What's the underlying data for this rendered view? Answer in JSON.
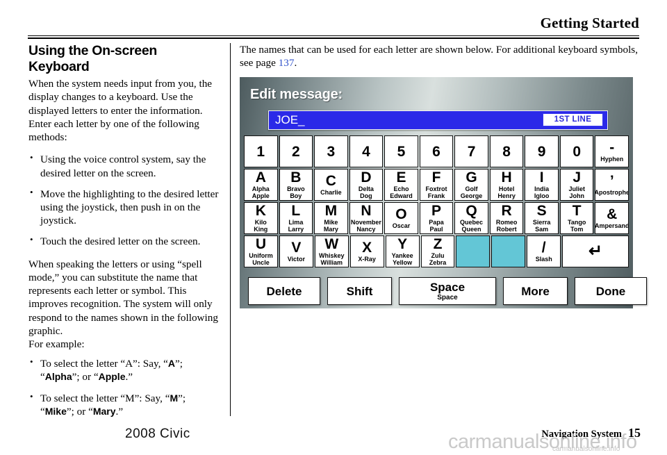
{
  "header": {
    "title": "Getting Started"
  },
  "left_column": {
    "heading": "Using the On-screen Keyboard",
    "intro": "When the system needs input from you, the display changes to a keyboard. Use the displayed letters to enter the information. Enter each letter by one of the following methods:",
    "bullets_1": [
      "Using the voice control system, say the desired letter on the screen.",
      "Move the highlighting to the desired letter using the joystick, then push in on the joystick.",
      "Touch the desired letter on the screen."
    ],
    "paragraph_2": "When speaking the letters or using “spell mode,” you can substitute the name that represents each letter or symbol. This improves recognition. The system will only respond to the names shown in the following graphic.",
    "paragraph_3": "For example:",
    "example_a": {
      "pre": "To select the letter “A”: Say, “",
      "b1": "A",
      "mid1": "”; “",
      "b2": "Alpha",
      "mid2": "”; or “",
      "b3": "Apple",
      "post": ".”"
    },
    "example_m": {
      "pre": "To select the letter “M”: Say, “",
      "b1": "M",
      "mid1": "”; “",
      "b2": "Mike",
      "mid2": "”; or “",
      "b3": "Mary",
      "post": ".”"
    }
  },
  "right_column": {
    "intro_pre": "The names that can be used for each letter are shown below. For additional keyboard symbols, see page ",
    "intro_page_ref": "137",
    "intro_post": "."
  },
  "keyboard": {
    "panel_title": "Edit message:",
    "text_field": {
      "value": "JOE_",
      "badge": "1ST LINE"
    },
    "rows": [
      [
        {
          "glyph": "1",
          "sub": []
        },
        {
          "glyph": "2",
          "sub": []
        },
        {
          "glyph": "3",
          "sub": []
        },
        {
          "glyph": "4",
          "sub": []
        },
        {
          "glyph": "5",
          "sub": []
        },
        {
          "glyph": "6",
          "sub": []
        },
        {
          "glyph": "7",
          "sub": []
        },
        {
          "glyph": "8",
          "sub": []
        },
        {
          "glyph": "9",
          "sub": []
        },
        {
          "glyph": "0",
          "sub": []
        },
        {
          "glyph": "-",
          "sub": [
            "Hyphen"
          ]
        }
      ],
      [
        {
          "glyph": "A",
          "sub": [
            "Alpha",
            "Apple"
          ]
        },
        {
          "glyph": "B",
          "sub": [
            "Bravo",
            "Boy"
          ]
        },
        {
          "glyph": "C",
          "sub": [
            "Charlie"
          ]
        },
        {
          "glyph": "D",
          "sub": [
            "Delta",
            "Dog"
          ]
        },
        {
          "glyph": "E",
          "sub": [
            "Echo",
            "Edward"
          ]
        },
        {
          "glyph": "F",
          "sub": [
            "Foxtrot",
            "Frank"
          ]
        },
        {
          "glyph": "G",
          "sub": [
            "Golf",
            "George"
          ]
        },
        {
          "glyph": "H",
          "sub": [
            "Hotel",
            "Henry"
          ]
        },
        {
          "glyph": "I",
          "sub": [
            "India",
            "Igloo"
          ]
        },
        {
          "glyph": "J",
          "sub": [
            "Juliet",
            "John"
          ]
        },
        {
          "glyph": "’",
          "sub": [
            "Apostrophe"
          ]
        }
      ],
      [
        {
          "glyph": "K",
          "sub": [
            "Kilo",
            "King"
          ]
        },
        {
          "glyph": "L",
          "sub": [
            "Lima",
            "Larry"
          ]
        },
        {
          "glyph": "M",
          "sub": [
            "Mike",
            "Mary"
          ]
        },
        {
          "glyph": "N",
          "sub": [
            "November",
            "Nancy"
          ]
        },
        {
          "glyph": "O",
          "sub": [
            "Oscar"
          ]
        },
        {
          "glyph": "P",
          "sub": [
            "Papa",
            "Paul"
          ]
        },
        {
          "glyph": "Q",
          "sub": [
            "Quebec",
            "Queen"
          ]
        },
        {
          "glyph": "R",
          "sub": [
            "Romeo",
            "Robert"
          ]
        },
        {
          "glyph": "S",
          "sub": [
            "Sierra",
            "Sam"
          ]
        },
        {
          "glyph": "T",
          "sub": [
            "Tango",
            "Tom"
          ]
        },
        {
          "glyph": "&",
          "sub": [
            "Ampersand"
          ]
        }
      ],
      [
        {
          "glyph": "U",
          "sub": [
            "Uniform",
            "Uncle"
          ]
        },
        {
          "glyph": "V",
          "sub": [
            "Victor"
          ]
        },
        {
          "glyph": "W",
          "sub": [
            "Whiskey",
            "William"
          ]
        },
        {
          "glyph": "X",
          "sub": [
            "X-Ray"
          ]
        },
        {
          "glyph": "Y",
          "sub": [
            "Yankee",
            "Yellow"
          ]
        },
        {
          "glyph": "Z",
          "sub": [
            "Zulu",
            "Zebra"
          ]
        },
        {
          "glyph": "",
          "sub": [],
          "blank": true
        },
        {
          "glyph": "",
          "sub": [],
          "blank": true
        },
        {
          "glyph": "/",
          "sub": [
            "Slash"
          ]
        },
        {
          "glyph": "↵",
          "sub": [],
          "wide": true
        }
      ]
    ],
    "commands": [
      {
        "label": "Delete",
        "sub": ""
      },
      {
        "label": "Shift",
        "sub": ""
      },
      {
        "label": "Space",
        "sub": "Space"
      },
      {
        "label": "More",
        "sub": ""
      },
      {
        "label": "Done",
        "sub": ""
      }
    ],
    "colors": {
      "field_blue": "#2b29e8",
      "blank_key_cyan": "#63c6d6",
      "badge_text": "#2b29d8"
    }
  },
  "footer": {
    "model": "2008  Civic",
    "nav_label": "Navigation System",
    "page_number": "15",
    "watermark": "carmanualsonline.info",
    "watermark_small": "carmanualsonline.info"
  }
}
